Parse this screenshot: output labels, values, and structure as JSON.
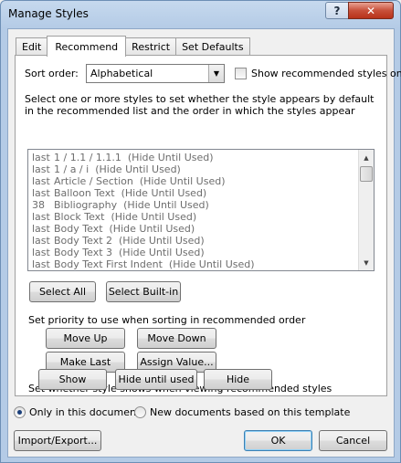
{
  "window": {
    "title": "Manage Styles",
    "help_label": "?",
    "close_label": "✕"
  },
  "tabs": [
    {
      "label": "Edit"
    },
    {
      "label": "Recommend"
    },
    {
      "label": "Restrict"
    },
    {
      "label": "Set Defaults"
    }
  ],
  "sort": {
    "label": "Sort order:",
    "value": "Alphabetical"
  },
  "show_recommended": {
    "label": "Show recommended styles only",
    "checked": false
  },
  "instructions": "Select one or more styles to set whether the style appears by default in the recommended list and the order in which the styles appear",
  "styles": [
    {
      "priority": "last",
      "name": "1 / 1.1 / 1.1.1",
      "state": "(Hide Until Used)"
    },
    {
      "priority": "last",
      "name": "1 / a / i",
      "state": "(Hide Until Used)"
    },
    {
      "priority": "last",
      "name": "Article / Section",
      "state": "(Hide Until Used)"
    },
    {
      "priority": "last",
      "name": "Balloon Text",
      "state": "(Hide Until Used)"
    },
    {
      "priority": "38",
      "name": "Bibliography",
      "state": "(Hide Until Used)"
    },
    {
      "priority": "last",
      "name": "Block Text",
      "state": "(Hide Until Used)"
    },
    {
      "priority": "last",
      "name": "Body Text",
      "state": "(Hide Until Used)"
    },
    {
      "priority": "last",
      "name": "Body Text 2",
      "state": "(Hide Until Used)"
    },
    {
      "priority": "last",
      "name": "Body Text 3",
      "state": "(Hide Until Used)"
    },
    {
      "priority": "last",
      "name": "Body Text First Indent",
      "state": "(Hide Until Used)"
    }
  ],
  "select_buttons": {
    "select_all": "Select All",
    "select_builtin": "Select Built-in"
  },
  "priority_section": {
    "label": "Set priority to use when sorting in recommended order",
    "move_up": "Move Up",
    "move_down": "Move Down",
    "make_last": "Make Last",
    "assign_value": "Assign Value..."
  },
  "visibility_section": {
    "label": "Set whether style shows when viewing recommended styles",
    "show": "Show",
    "hide_until_used": "Hide until used",
    "hide": "Hide"
  },
  "scope": {
    "only_this_document": "Only in this document",
    "new_documents": "New documents based on this template",
    "selected": "only_this_document"
  },
  "footer": {
    "import_export": "Import/Export...",
    "ok": "OK",
    "cancel": "Cancel"
  }
}
